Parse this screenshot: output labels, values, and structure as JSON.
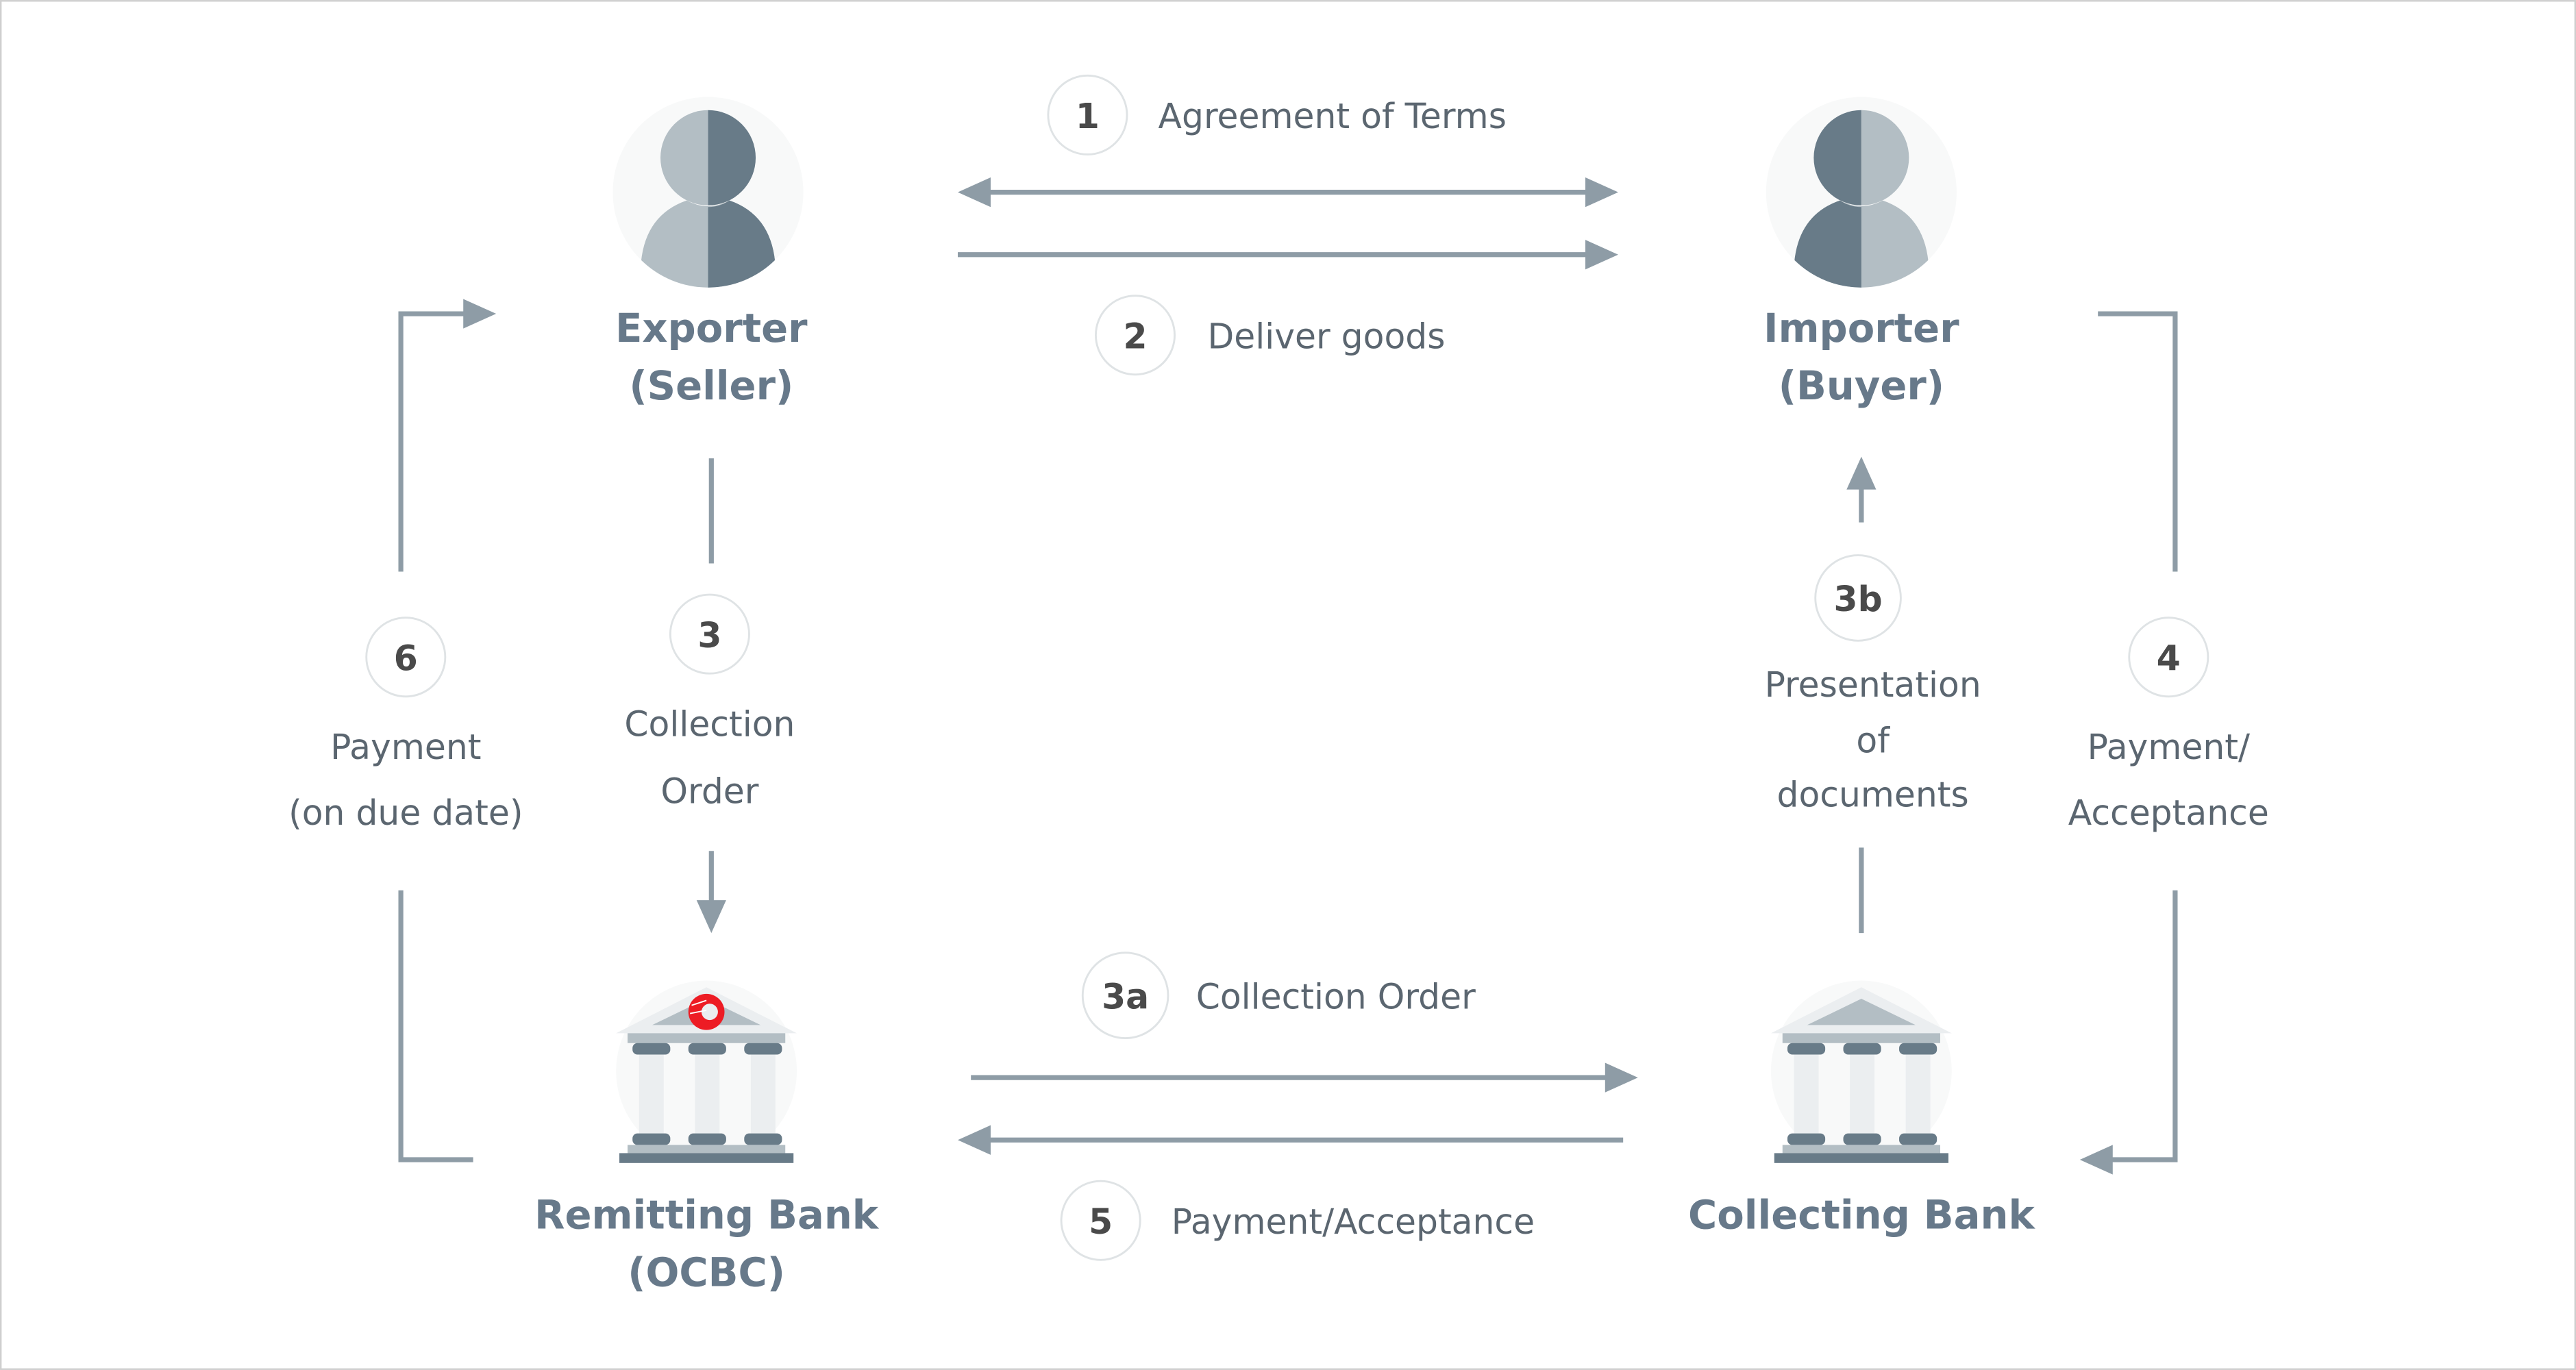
{
  "colors": {
    "arrow": "#8e9ca6",
    "icon_dark": "#687b88",
    "icon_light": "#b3bec4",
    "name_text": "#67798a",
    "label_text": "#5b6670",
    "ocbc_red": "#ed1c24"
  },
  "parties": {
    "exporter": {
      "line1": "Exporter",
      "line2": "(Seller)",
      "icon": "person-icon"
    },
    "importer": {
      "line1": "Importer",
      "line2": "(Buyer)",
      "icon": "person-icon"
    },
    "remitting_bank": {
      "line1": "Remitting Bank",
      "line2": "(OCBC)",
      "icon": "bank-icon",
      "logo": "OCBC"
    },
    "collecting_bank": {
      "line1": "Collecting Bank",
      "icon": "bank-icon"
    }
  },
  "steps": {
    "s1": {
      "num": "1",
      "label": "Agreement of Terms"
    },
    "s2": {
      "num": "2",
      "label": "Deliver goods"
    },
    "s3": {
      "num": "3",
      "line1": "Collection",
      "line2": "Order"
    },
    "s3a": {
      "num": "3a",
      "label": "Collection Order"
    },
    "s3b": {
      "num": "3b",
      "line1": "Presentation",
      "line2": "of",
      "line3": "documents"
    },
    "s4": {
      "num": "4",
      "line1": "Payment/",
      "line2": "Acceptance"
    },
    "s5": {
      "num": "5",
      "label": "Payment/Acceptance"
    },
    "s6": {
      "num": "6",
      "line1": "Payment",
      "line2": "(on due date)"
    }
  }
}
